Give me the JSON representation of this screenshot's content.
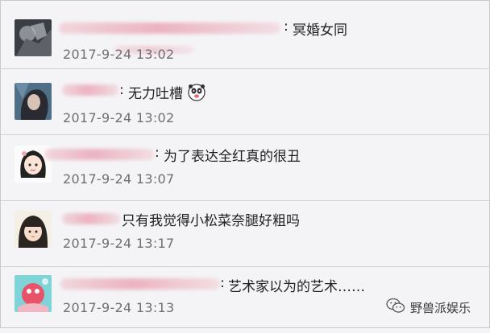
{
  "comments": [
    {
      "separator": ":",
      "text": "冥婚女同",
      "time": "2017-9-24 13:02"
    },
    {
      "separator": ":",
      "text": "无力吐槽",
      "time": "2017-9-24 13:02",
      "emoji_icon": "panda-face-icon"
    },
    {
      "separator": ":",
      "text": "为了表达全红真的很丑",
      "time": "2017-9-24 13:07"
    },
    {
      "separator": "",
      "text": "只有我觉得小松菜奈腿好粗吗",
      "time": "2017-9-24 13:17"
    },
    {
      "separator": ":",
      "text": "艺术家以为的艺术……",
      "time": "2017-9-24 13:13"
    }
  ],
  "watermark": {
    "icon": "wechat-icon",
    "label": "野兽派娱乐"
  },
  "colors": {
    "background": "#f4f4f6",
    "divider": "#cfd0d6",
    "name_blur": "#ebafbe",
    "time": "#6f6f6f"
  }
}
